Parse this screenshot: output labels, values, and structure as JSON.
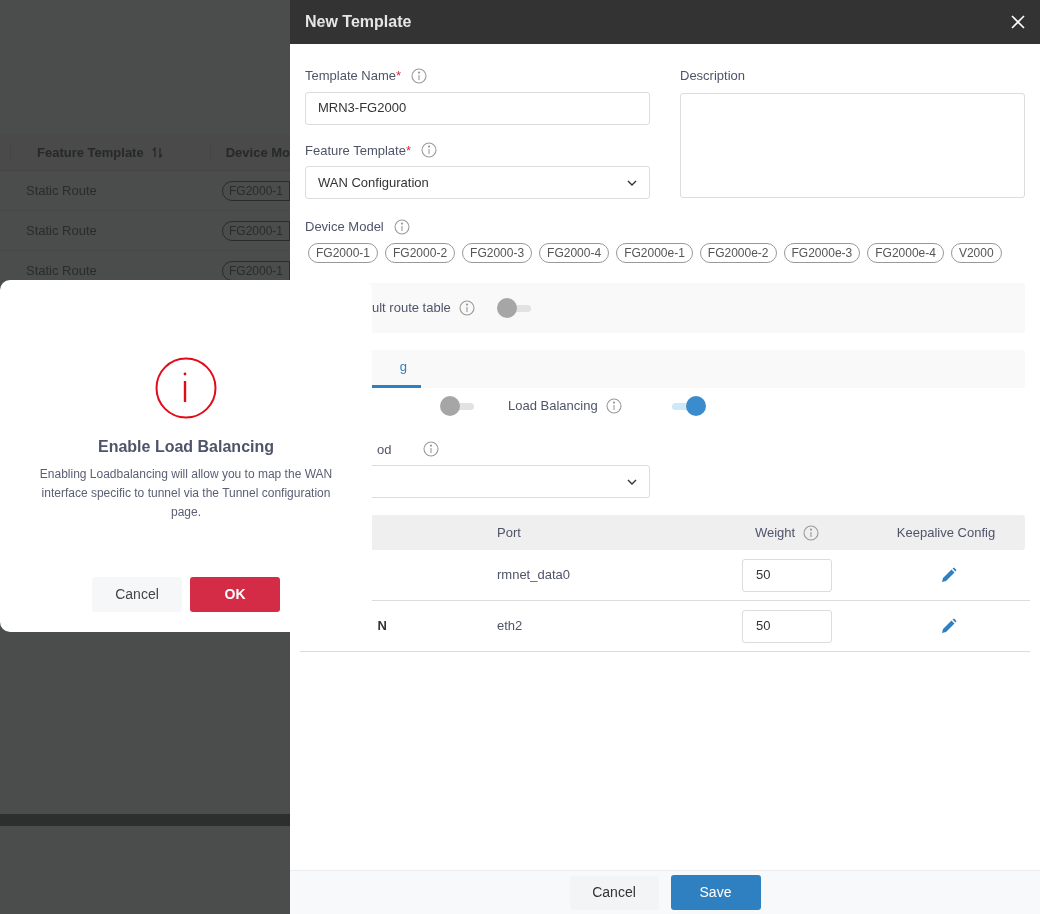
{
  "background": {
    "columns": [
      {
        "label": "Feature Template",
        "sortable": true
      },
      {
        "label": "Device Mo"
      }
    ],
    "rows": [
      {
        "feature_template": "Static Route",
        "device_model": "FG2000-1"
      },
      {
        "feature_template": "Static Route",
        "device_model": "FG2000-1"
      },
      {
        "feature_template": "Static Route",
        "device_model": "FG2000-1"
      }
    ]
  },
  "drawer": {
    "title": "New Template",
    "template_name": {
      "label": "Template Name",
      "required_mark": "*",
      "value": "MRN3-FG2000"
    },
    "description": {
      "label": "Description"
    },
    "feature_template": {
      "label": "Feature Template",
      "required_mark": "*",
      "value": "WAN Configuration"
    },
    "device_model": {
      "label": "Device Model",
      "chips": [
        "FG2000-1",
        "FG2000-2",
        "FG2000-3",
        "FG2000-4",
        "FG2000e-1",
        "FG2000e-2",
        "FG2000e-3",
        "FG2000e-4",
        "V2000"
      ]
    },
    "route_table": {
      "label": "ult route table",
      "on": false
    },
    "tabs": [
      {
        "label": "g",
        "selected": true
      }
    ],
    "toggles": [
      {
        "on": false
      },
      {
        "label": "Load Balancing",
        "on": true
      }
    ],
    "method": {
      "label": "od"
    },
    "wan_table": {
      "columns": [
        "Port",
        "Weight",
        "Keepalive Config"
      ],
      "rows": [
        {
          "port": "rmnet_data0",
          "weight": "50"
        },
        {
          "interface": "N",
          "port": "eth2",
          "weight": "50"
        }
      ]
    },
    "footer": {
      "cancel": "Cancel",
      "save": "Save"
    }
  },
  "dialog": {
    "title": "Enable Load Balancing",
    "message": "Enabling Loadbalancing will allow you to map the WAN interface specific to tunnel via the Tunnel configuration page.",
    "cancel": "Cancel",
    "ok": "OK"
  }
}
